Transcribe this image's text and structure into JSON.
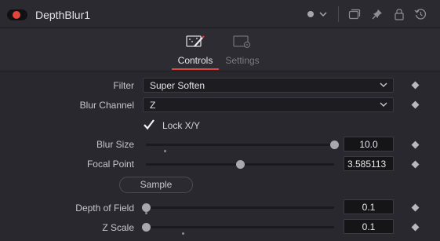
{
  "header": {
    "title": "DepthBlur1",
    "accent_color": "#e0453e"
  },
  "tabs": [
    {
      "label": "Controls",
      "active": true,
      "icon": "magic-wand-icon"
    },
    {
      "label": "Settings",
      "active": false,
      "icon": "settings-screen-icon"
    }
  ],
  "controls": {
    "filter": {
      "label": "Filter",
      "value": "Super Soften"
    },
    "blur_channel": {
      "label": "Blur Channel",
      "value": "Z"
    },
    "lock_xy": {
      "label": "Lock X/Y",
      "checked": true
    },
    "blur_size": {
      "label": "Blur Size",
      "value": "10.0",
      "fraction": 1.0
    },
    "focal_point": {
      "label": "Focal Point",
      "value": "3.585113",
      "fraction": 0.5
    },
    "sample": {
      "label": "Sample"
    },
    "depth_of_field": {
      "label": "Depth of Field",
      "value": "0.1",
      "fraction": 0.0
    },
    "z_scale": {
      "label": "Z Scale",
      "value": "0.1",
      "fraction": 0.0
    }
  }
}
